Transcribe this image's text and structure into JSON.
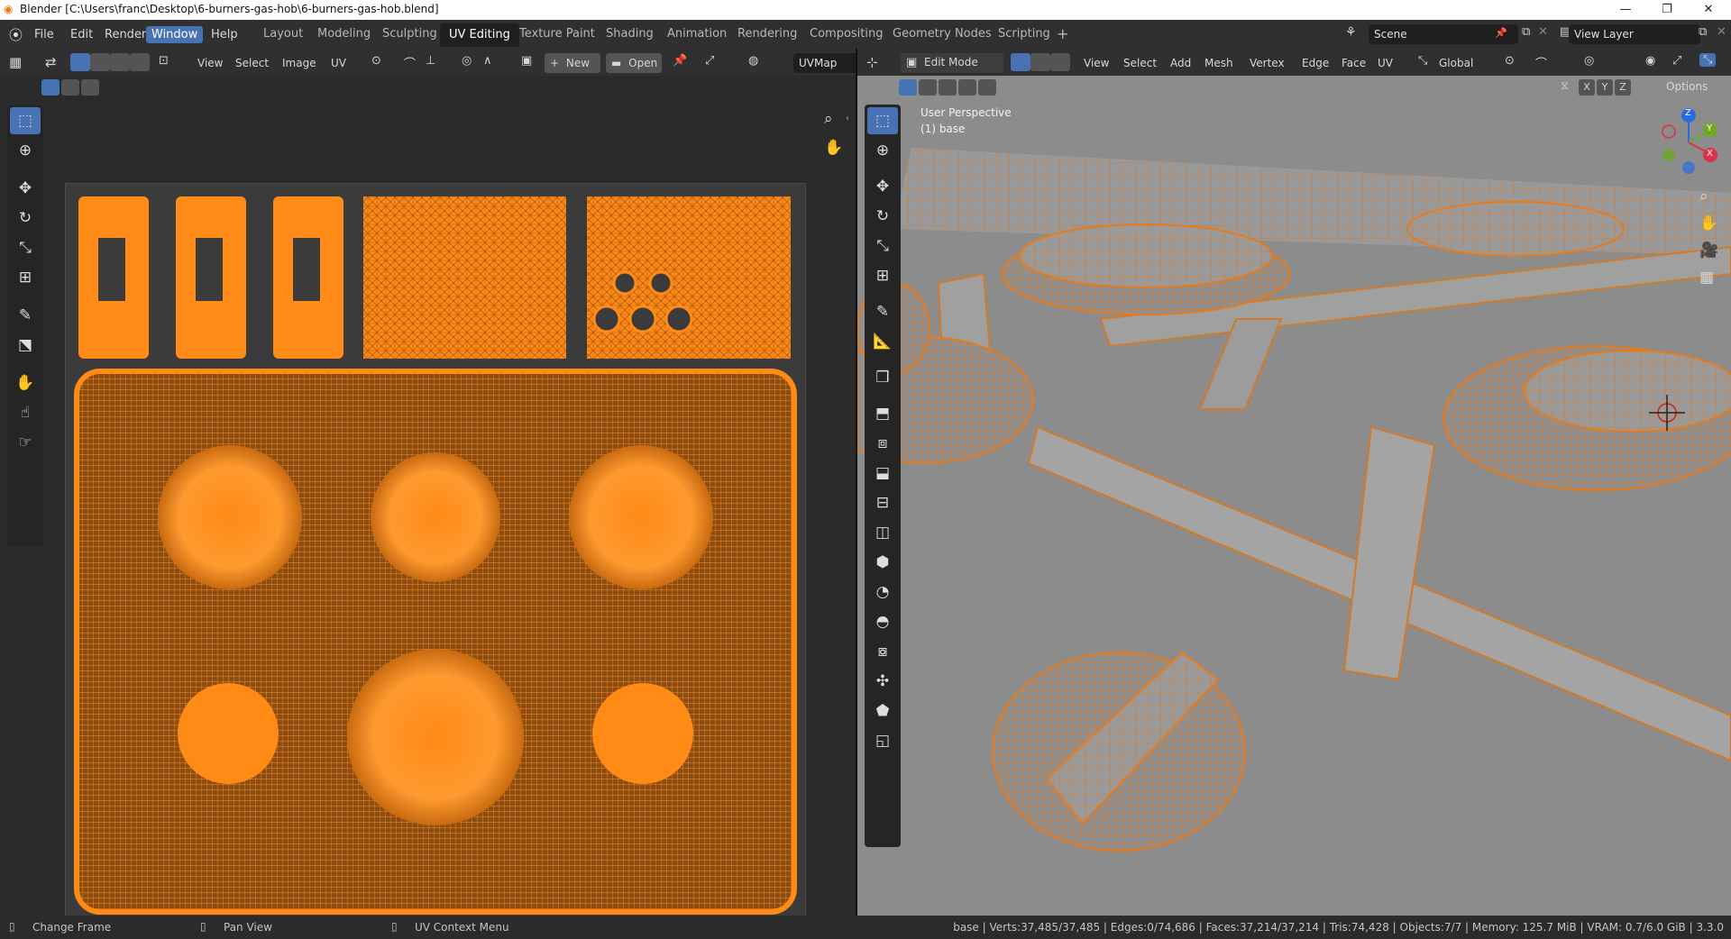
{
  "window": {
    "title": "Blender [C:\\Users\\franc\\Desktop\\6-burners-gas-hob\\6-burners-gas-hob.blend]"
  },
  "menus": [
    "File",
    "Edit",
    "Render",
    "Window",
    "Help"
  ],
  "workspaces": [
    "Layout",
    "Modeling",
    "Sculpting",
    "UV Editing",
    "Texture Paint",
    "Shading",
    "Animation",
    "Rendering",
    "Compositing",
    "Geometry Nodes",
    "Scripting"
  ],
  "active_workspace": "UV Editing",
  "scene": {
    "name": "Scene"
  },
  "view_layer": {
    "name": "View Layer"
  },
  "uv_editor": {
    "menus": [
      "View",
      "Select",
      "Image",
      "UV"
    ],
    "new_label": "New",
    "open_label": "Open",
    "uvmap": "UVMap"
  },
  "viewport": {
    "mode": "Edit Mode",
    "menus": [
      "View",
      "Select",
      "Add",
      "Mesh",
      "Vertex",
      "Edge",
      "Face",
      "UV"
    ],
    "orientation": "Global",
    "options_label": "Options",
    "axes": [
      "X",
      "Y",
      "Z"
    ],
    "overlay_title": "User Perspective",
    "overlay_object": "(1) base",
    "gizmo_labels": [
      "Z",
      "Y",
      "X"
    ]
  },
  "status": {
    "left_items": [
      "Change Frame",
      "Pan View",
      "UV Context Menu"
    ],
    "stats": "base | Verts:37,485/37,485 | Edges:0/74,686 | Faces:37,214/37,214 | Tris:74,428 | Objects:7/7 | Memory: 125.7 MiB | VRAM: 0.7/6.0 GiB | 3.3.0"
  },
  "colors": {
    "accent": "#4772b3",
    "uv_orange": "#ff8a16",
    "edge_orange": "#e87a1a"
  },
  "icons": [
    "blender-logo-icon",
    "select-box-icon",
    "cursor-icon",
    "move-icon",
    "rotate-icon",
    "scale-icon",
    "transform-icon",
    "annotate-icon",
    "measure-icon",
    "extrude-icon",
    "inset-icon",
    "bevel-icon",
    "loop-cut-icon",
    "knife-icon",
    "poly-build-icon",
    "spin-icon",
    "smooth-icon",
    "shrink-icon",
    "shear-icon",
    "rip-icon",
    "zoom-icon",
    "hand-icon",
    "camera-icon",
    "grid-icon"
  ]
}
